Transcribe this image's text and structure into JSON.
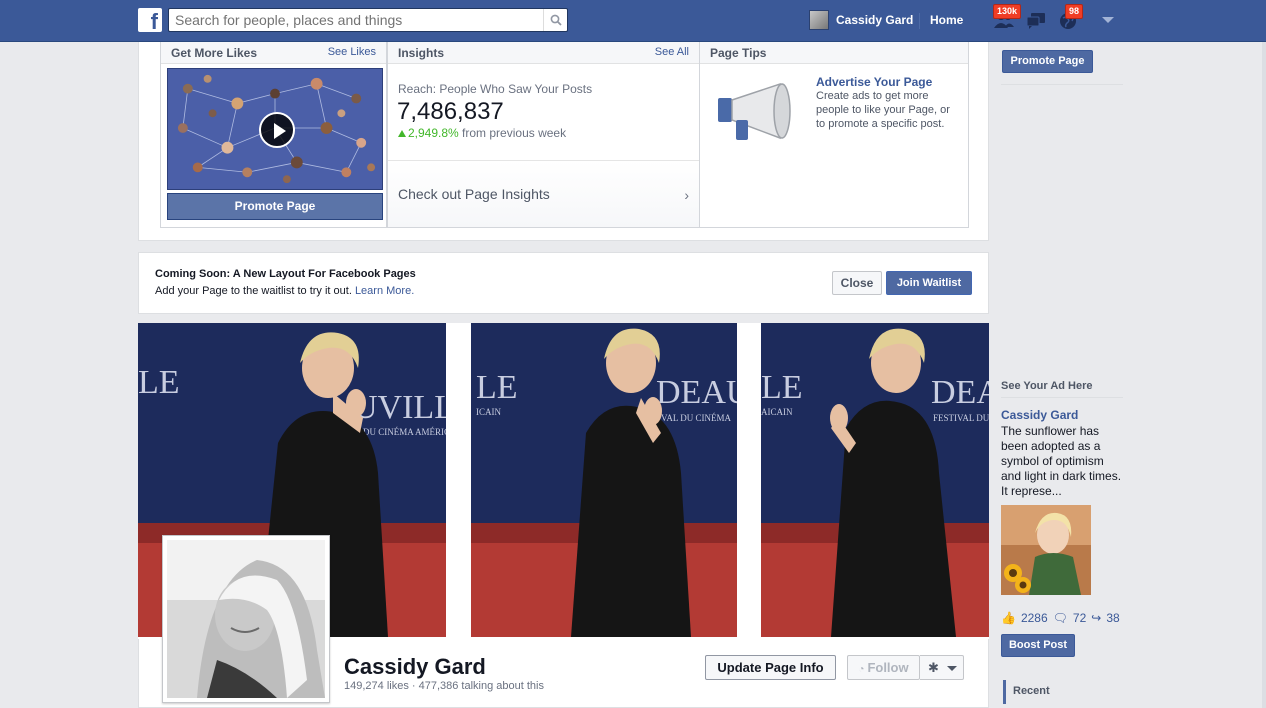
{
  "topbar": {
    "logo": "f",
    "search_placeholder": "Search for people, places and things",
    "user_name": "Cassidy Gard",
    "home_label": "Home",
    "friends_badge": "130k",
    "messages_badge": "",
    "notifications_badge": "98"
  },
  "admin": {
    "likes_card": {
      "title": "Get More Likes",
      "link": "See Likes",
      "button": "Promote Page"
    },
    "insights_card": {
      "title": "Insights",
      "link": "See All",
      "reach_label": "Reach: People Who Saw Your Posts",
      "reach_value": "7,486,837",
      "change_value": "2,949.8%",
      "change_suffix": " from previous week",
      "cta": "Check out Page Insights"
    },
    "tips_card": {
      "title": "Page Tips",
      "tip_title": "Advertise Your Page",
      "tip_text": "Create ads to get more people to like your Page, or to promote a specific post."
    }
  },
  "coming_soon": {
    "title": "Coming Soon: A New Layout For Facebook Pages",
    "text": "Add your Page to the waitlist to try it out. ",
    "link": "Learn More.",
    "close_label": "Close",
    "join_label": "Join Waitlist"
  },
  "cover": {
    "banner_text_1": "LE",
    "banner_text_2": "UVILLE",
    "banner_text_3": "DEAUV",
    "banner_text_4": "LE",
    "banner_text_5": "DEA",
    "banner_sub_1": "DU CINÉMA AMÉRICAIN",
    "banner_sub_2": "ICAIN",
    "banner_sub_3": "VAL DU CINÉMA",
    "banner_sub_4": "AICAIN",
    "banner_sub_5": "FESTIVAL DU"
  },
  "page_header": {
    "name": "Cassidy Gard",
    "stats": "149,274 likes · 477,386 talking about this",
    "update_label": "Update Page Info",
    "follow_label": "Follow"
  },
  "right_column": {
    "promote_label": "Promote Page",
    "ad_header": "See Your Ad Here",
    "ad_title": "Cassidy Gard",
    "ad_text": "The sunflower has been adopted as a symbol of optimism and light in dark times. It represe...",
    "likes": "2286",
    "comments": "72",
    "shares": "38",
    "boost_label": "Boost Post",
    "recent_label": "Recent"
  },
  "colors": {
    "brand": "#3b5998",
    "button_blue": "#4e69a2",
    "positive": "#42b72a",
    "badge": "#f03d25",
    "red_carpet": "#c0392b"
  }
}
